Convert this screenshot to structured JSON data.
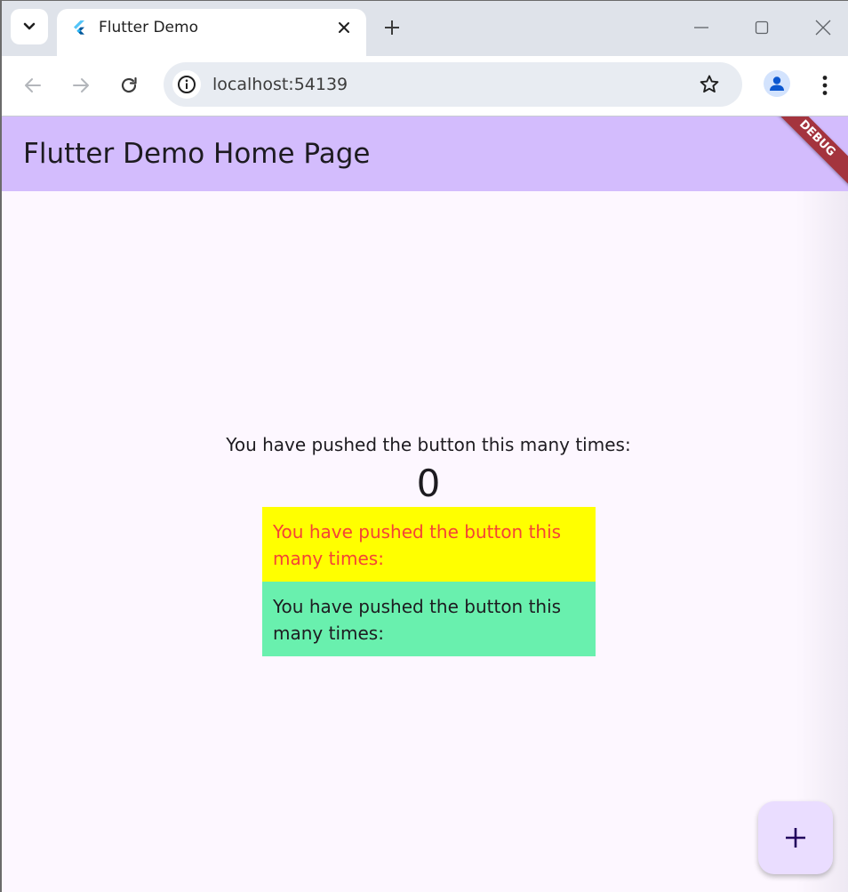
{
  "browser": {
    "tab": {
      "title": "Flutter Demo",
      "favicon": "flutter-logo-icon",
      "close_icon": "close-icon"
    },
    "new_tab_icon": "plus-icon",
    "window_controls": [
      "minimize-icon",
      "maximize-icon",
      "close-icon"
    ],
    "toolbar": {
      "back_icon": "arrow-left-icon",
      "forward_icon": "arrow-right-icon",
      "reload_icon": "reload-icon",
      "url": "localhost:54139",
      "site_info_icon": "info-icon",
      "bookmark_icon": "star-icon",
      "profile_icon": "person-icon",
      "menu_icon": "kebab-menu-icon"
    }
  },
  "app": {
    "appbar_title": "Flutter Demo Home Page",
    "debug_banner": "DEBUG",
    "counter_label": "You have pushed the button this many times:",
    "counter_value": "0",
    "yellow_box_text": "You have pushed the button this many times:",
    "green_box_text": "You have pushed the button this many times:",
    "fab_icon": "plus-icon",
    "colors": {
      "appbar": "#d3bcfd",
      "background": "#fdf7ff",
      "yellow_box": "#ffff00",
      "yellow_box_text": "#f44336",
      "green_box": "#69f0ae",
      "fab": "#eaddff",
      "debug_banner": "#a4343e"
    }
  }
}
